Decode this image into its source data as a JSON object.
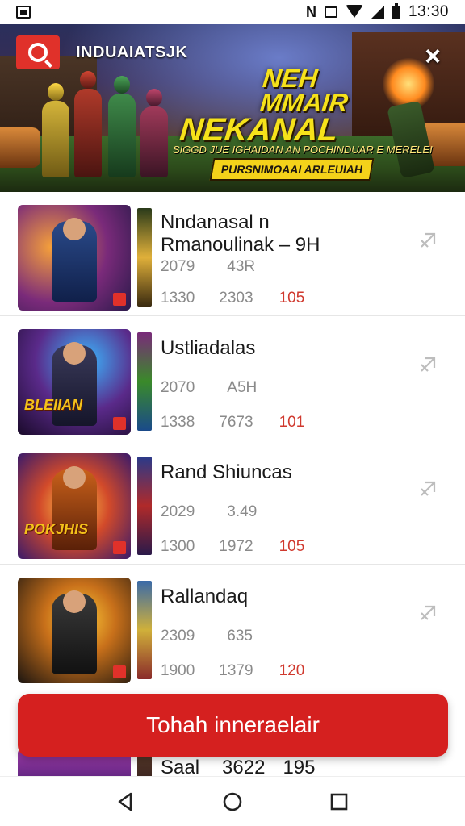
{
  "status_bar": {
    "time": "13:30",
    "icons": [
      "screenshot-icon",
      "nfc-icon",
      "vibrate-icon",
      "wifi-icon",
      "signal-icon",
      "battery-icon"
    ]
  },
  "banner": {
    "app_name": "INDUAIATSJK",
    "headline_line1": "NEH MMAIR",
    "headline_line2": "NEKANAL",
    "subtitle": "SIGGD JUE IGHAIDAN AN POCHINDUAR E MERELEI",
    "ribbon": "PURSNIMOAAI ARLEUIAH",
    "close_label": "×",
    "icons": [
      "search-icon",
      "close-icon"
    ]
  },
  "list": {
    "items": [
      {
        "title": "Nndanasal  n",
        "title2": "Rmanoulinak – 9H",
        "v1": "2079",
        "v2": "43R",
        "s1": "1330",
        "s2": "2303",
        "s3": "105",
        "thumb_text": ""
      },
      {
        "title": "Ustliadalas",
        "title2": "",
        "v1": "2070",
        "v2": "A5H",
        "s1": "1338",
        "s2": "7673",
        "s3": "101",
        "thumb_text": "BLEIIAN"
      },
      {
        "title": "Rand Shiuncas",
        "title2": "",
        "v1": "2029",
        "v2": "3.49",
        "s1": "1300",
        "s2": "1972",
        "s3": "105",
        "thumb_text": "POKJHIS"
      },
      {
        "title": "Rallandaq",
        "title2": "",
        "v1": "2309",
        "v2": "635",
        "s1": "1900",
        "s2": "1379",
        "s3": "120",
        "thumb_text": ""
      }
    ],
    "partial": {
      "t1": "Saal",
      "t2": "3622",
      "t3": "195"
    }
  },
  "cta": {
    "label": "Tohah inneraelair"
  },
  "nav": {
    "icons": [
      "back-icon",
      "home-icon",
      "recents-icon"
    ]
  },
  "colors": {
    "accent": "#d5201f",
    "stat_highlight": "#d0392e",
    "banner_headline": "#f6e21a"
  }
}
